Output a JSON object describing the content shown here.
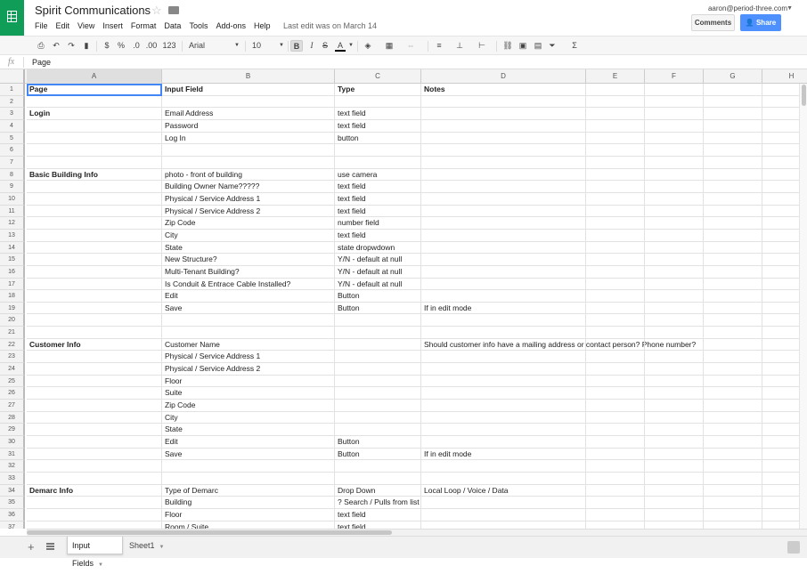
{
  "app": {
    "doc_title": "Spirit Communications",
    "last_edit": "Last edit was on March 14",
    "user_email": "aaron@period-three.com",
    "comments_label": "Comments",
    "share_label": "Share",
    "brand_color": "#0f9d58",
    "share_color": "#4d90fe"
  },
  "menu": [
    "File",
    "Edit",
    "View",
    "Insert",
    "Format",
    "Data",
    "Tools",
    "Add-ons",
    "Help"
  ],
  "toolbar": {
    "currency": "$",
    "percent": "%",
    "dec_decrease": ".0",
    "dec_increase": ".00",
    "more_formats": "123",
    "font": "Arial",
    "font_size": "10",
    "bold": "B",
    "italic": "I",
    "strike": "S",
    "text_color": "A",
    "functions": "Σ"
  },
  "formula": {
    "fx_label": "fx",
    "value": "Page"
  },
  "columns": [
    "A",
    "B",
    "C",
    "D",
    "E",
    "F",
    "G",
    "H"
  ],
  "rows": [
    {
      "n": "1",
      "a": "Page",
      "b": "Input Field",
      "c": "Type",
      "d": "Notes",
      "bold": true
    },
    {
      "n": "2",
      "a": "",
      "b": "",
      "c": "",
      "d": ""
    },
    {
      "n": "3",
      "a": "Login",
      "b": "Email Address",
      "c": "text field",
      "d": "",
      "bold_a": true
    },
    {
      "n": "4",
      "a": "",
      "b": "Password",
      "c": "text field",
      "d": ""
    },
    {
      "n": "5",
      "a": "",
      "b": "Log In",
      "c": "button",
      "d": ""
    },
    {
      "n": "6",
      "a": "",
      "b": "",
      "c": "",
      "d": ""
    },
    {
      "n": "7",
      "a": "",
      "b": "",
      "c": "",
      "d": ""
    },
    {
      "n": "8",
      "a": "Basic Building Info",
      "b": "photo - front of building",
      "c": "use camera",
      "d": "",
      "bold_a": true
    },
    {
      "n": "9",
      "a": "",
      "b": "Building Owner Name?????",
      "c": "text field",
      "d": ""
    },
    {
      "n": "10",
      "a": "",
      "b": "Physical / Service Address 1",
      "c": "text field",
      "d": ""
    },
    {
      "n": "11",
      "a": "",
      "b": "Physical / Service Address 2",
      "c": "text field",
      "d": ""
    },
    {
      "n": "12",
      "a": "",
      "b": "Zip Code",
      "c": "number field",
      "d": ""
    },
    {
      "n": "13",
      "a": "",
      "b": "City",
      "c": "text field",
      "d": ""
    },
    {
      "n": "14",
      "a": "",
      "b": "State",
      "c": "state dropwdown",
      "d": ""
    },
    {
      "n": "15",
      "a": "",
      "b": "New Structure?",
      "c": "Y/N - default at null",
      "d": ""
    },
    {
      "n": "16",
      "a": "",
      "b": "Multi-Tenant Building?",
      "c": "Y/N - default at null",
      "d": ""
    },
    {
      "n": "17",
      "a": "",
      "b": "Is Conduit & Entrace Cable Installed?",
      "c": "Y/N - default at null",
      "d": ""
    },
    {
      "n": "18",
      "a": "",
      "b": "Edit",
      "c": "Button",
      "d": ""
    },
    {
      "n": "19",
      "a": "",
      "b": "Save",
      "c": "Button",
      "d": "If in edit mode"
    },
    {
      "n": "20",
      "a": "",
      "b": "",
      "c": "",
      "d": ""
    },
    {
      "n": "21",
      "a": "",
      "b": "",
      "c": "",
      "d": ""
    },
    {
      "n": "22",
      "a": "Customer Info",
      "b": "Customer Name",
      "c": "",
      "d": "Should customer info have a mailing address or contact person? Phone number?",
      "bold_a": true
    },
    {
      "n": "23",
      "a": "",
      "b": "Physical / Service Address 1",
      "c": "",
      "d": ""
    },
    {
      "n": "24",
      "a": "",
      "b": "Physical / Service Address 2",
      "c": "",
      "d": ""
    },
    {
      "n": "25",
      "a": "",
      "b": "Floor",
      "c": "",
      "d": ""
    },
    {
      "n": "26",
      "a": "",
      "b": "Suite",
      "c": "",
      "d": ""
    },
    {
      "n": "27",
      "a": "",
      "b": "Zip Code",
      "c": "",
      "d": ""
    },
    {
      "n": "28",
      "a": "",
      "b": "City",
      "c": "",
      "d": ""
    },
    {
      "n": "29",
      "a": "",
      "b": "State",
      "c": "",
      "d": ""
    },
    {
      "n": "30",
      "a": "",
      "b": "Edit",
      "c": "Button",
      "d": ""
    },
    {
      "n": "31",
      "a": "",
      "b": "Save",
      "c": "Button",
      "d": "If in edit mode"
    },
    {
      "n": "32",
      "a": "",
      "b": "",
      "c": "",
      "d": ""
    },
    {
      "n": "33",
      "a": "",
      "b": "",
      "c": "",
      "d": ""
    },
    {
      "n": "34",
      "a": "Demarc Info",
      "b": "Type of Demarc",
      "c": "Drop Down",
      "d": "Local Loop / Voice / Data",
      "bold_a": true
    },
    {
      "n": "35",
      "a": "",
      "b": "Building",
      "c": "? Search / Pulls from list",
      "d": ""
    },
    {
      "n": "36",
      "a": "",
      "b": "Floor",
      "c": "text field",
      "d": ""
    },
    {
      "n": "37",
      "a": "",
      "b": "Room / Suite",
      "c": "text field",
      "d": ""
    }
  ],
  "sheets": [
    "Input Fields",
    "Sheet1"
  ]
}
